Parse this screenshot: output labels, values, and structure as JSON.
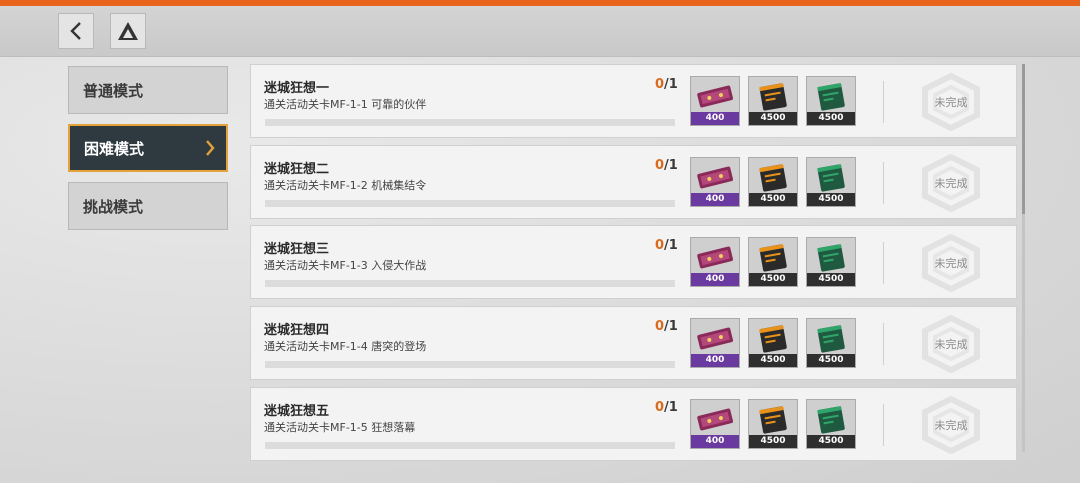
{
  "colors": {
    "accent": "#e8631c",
    "active_bg": "#2f3a40",
    "active_border": "#e3a23a"
  },
  "header": {
    "back_icon": "chevron-left-icon",
    "home_icon": "triangle-logo-icon"
  },
  "modes": [
    {
      "label": "普通模式",
      "active": false
    },
    {
      "label": "困难模式",
      "active": true
    },
    {
      "label": "挑战模式",
      "active": false
    }
  ],
  "tasks": [
    {
      "name": "迷城狂想一",
      "desc": "通关活动关卡MF-1-1 可靠的伙伴",
      "current": "0",
      "total": "/1",
      "progress": 0,
      "rewards": [
        {
          "amount": "400",
          "color": "#6a3aa0",
          "kind": "ticket"
        },
        {
          "amount": "4500",
          "color": "#2f2f2f",
          "kind": "orange-card"
        },
        {
          "amount": "4500",
          "color": "#2f2f2f",
          "kind": "green-card"
        }
      ],
      "status": "未完成"
    },
    {
      "name": "迷城狂想二",
      "desc": "通关活动关卡MF-1-2 机械集结令",
      "current": "0",
      "total": "/1",
      "progress": 0,
      "rewards": [
        {
          "amount": "400",
          "color": "#6a3aa0",
          "kind": "ticket"
        },
        {
          "amount": "4500",
          "color": "#2f2f2f",
          "kind": "orange-card"
        },
        {
          "amount": "4500",
          "color": "#2f2f2f",
          "kind": "green-card"
        }
      ],
      "status": "未完成"
    },
    {
      "name": "迷城狂想三",
      "desc": "通关活动关卡MF-1-3 入侵大作战",
      "current": "0",
      "total": "/1",
      "progress": 0,
      "rewards": [
        {
          "amount": "400",
          "color": "#6a3aa0",
          "kind": "ticket"
        },
        {
          "amount": "4500",
          "color": "#2f2f2f",
          "kind": "orange-card"
        },
        {
          "amount": "4500",
          "color": "#2f2f2f",
          "kind": "green-card"
        }
      ],
      "status": "未完成"
    },
    {
      "name": "迷城狂想四",
      "desc": "通关活动关卡MF-1-4 唐突的登场",
      "current": "0",
      "total": "/1",
      "progress": 0,
      "rewards": [
        {
          "amount": "400",
          "color": "#6a3aa0",
          "kind": "ticket"
        },
        {
          "amount": "4500",
          "color": "#2f2f2f",
          "kind": "orange-card"
        },
        {
          "amount": "4500",
          "color": "#2f2f2f",
          "kind": "green-card"
        }
      ],
      "status": "未完成"
    },
    {
      "name": "迷城狂想五",
      "desc": "通关活动关卡MF-1-5 狂想落幕",
      "current": "0",
      "total": "/1",
      "progress": 0,
      "rewards": [
        {
          "amount": "400",
          "color": "#6a3aa0",
          "kind": "ticket"
        },
        {
          "amount": "4500",
          "color": "#2f2f2f",
          "kind": "orange-card"
        },
        {
          "amount": "4500",
          "color": "#2f2f2f",
          "kind": "green-card"
        }
      ],
      "status": "未完成"
    }
  ]
}
